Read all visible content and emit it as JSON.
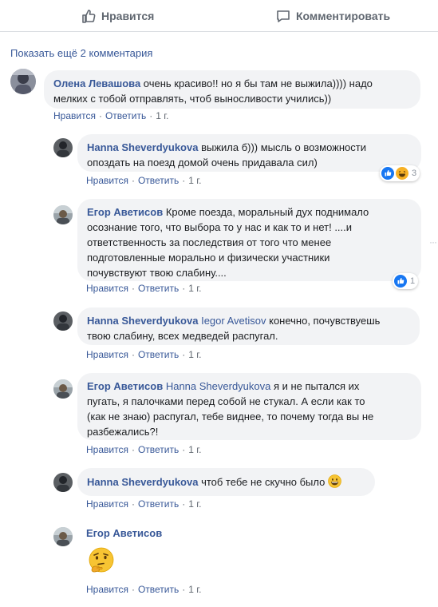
{
  "actions": {
    "like_label": "Нравится",
    "comment_label": "Комментировать"
  },
  "show_more": "Показать ещё 2 комментария",
  "comment_links": {
    "like": "Нравится",
    "reply": "Ответить"
  },
  "colors": {
    "link": "#385898",
    "bubble": "#f2f3f5",
    "meta": "#606770",
    "like_blue": "#1877f2"
  },
  "comments": [
    {
      "author": "Олена Левашова",
      "text_line1": " очень красиво!! но я бы там не выжила)))) надо",
      "text_line2": "мелких с тобой отправлять, чтоб выносливости учились))",
      "time": "1 г."
    },
    {
      "author": "Hanna Sheverdyukova",
      "text_line1": " выжила б))) мысль о возможности",
      "text_line2": "опоздать на поезд домой очень придавала сил)",
      "time": "1 г.",
      "reactions": {
        "icons": [
          "like-icon",
          "haha-icon"
        ],
        "count": "3"
      }
    },
    {
      "author": "Егор Аветисов",
      "text_line1": " Кроме поезда, моральный дух поднимало",
      "text_line2": "осознание того, что выбора то у нас и как то и нет! ....и",
      "text_line3": "ответственность за последствия от того что менее",
      "text_line4": "подготовленные морально и физически участники",
      "text_line5": "почувствуют твою слабину....",
      "time": "1 г.",
      "reactions": {
        "icons": [
          "like-icon"
        ],
        "count": "1"
      }
    },
    {
      "author": "Hanna Sheverdyukova",
      "mention": "Iegor Avetisov",
      "text_line1": " конечно, почувствуешь",
      "text_line2": "твою слабину, всех медведей распугал.",
      "time": "1 г."
    },
    {
      "author": "Егор Аветисов",
      "mention": "Hanna Sheverdyukova",
      "text_line1": " я и не пытался их",
      "text_line2": "пугать, я палочками перед собой не стукал. А если как то",
      "text_line3": "(как не знаю) распугал, тебе виднее, то почему тогда вы не",
      "text_line4": "разбежались?!",
      "time": "1 г."
    },
    {
      "author": "Hanna Sheverdyukova",
      "text_line1": " чтоб тебе не скучно было ",
      "emoji": "grinning-emoji",
      "time": "1 г."
    },
    {
      "author": "Егор Аветисов",
      "emoji": "thinking-face-emoji",
      "time": "1 г."
    }
  ]
}
